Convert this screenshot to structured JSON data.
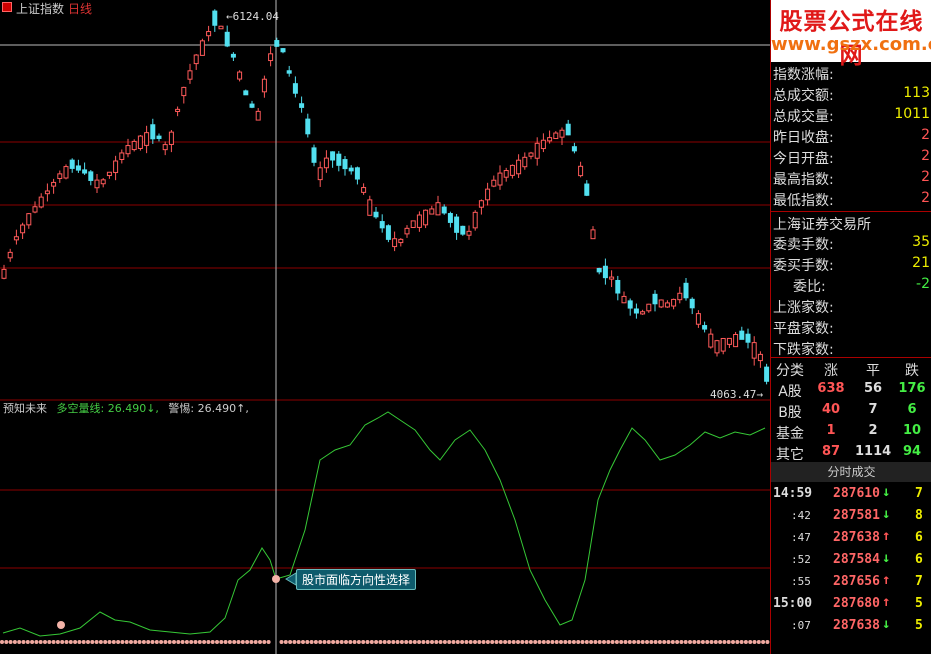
{
  "window": {
    "index_name": "上证指数",
    "period": "日线"
  },
  "chart_labels": {
    "high": "6124.04",
    "low": "4063.47"
  },
  "indicator": {
    "name": "预知未来",
    "line_name": "多空量线:",
    "line_value": "26.490↓,",
    "alert_name": "警惕:",
    "alert_value": "26.490↑,",
    "tooltip": "股市面临方向性选择"
  },
  "logo": {
    "line1": "股票公式在线网",
    "line2": "www.gszx.com.cn"
  },
  "stats": [
    {
      "label": "指数涨幅:",
      "value": ""
    },
    {
      "label": "总成交额:",
      "value": "113"
    },
    {
      "label": "总成交量:",
      "value": "1011"
    },
    {
      "label": "昨日收盘:",
      "value": "2"
    },
    {
      "label": "今日开盘:",
      "value": "2"
    },
    {
      "label": "最高指数:",
      "value": "2"
    },
    {
      "label": "最低指数:",
      "value": "2"
    }
  ],
  "exchange": {
    "title": "上海证券交易所",
    "rows": [
      {
        "label": "委卖手数:",
        "value": "35"
      },
      {
        "label": "委买手数:",
        "value": "21"
      },
      {
        "label": "委比:",
        "value": "-2"
      },
      {
        "label": "上涨家数:",
        "value": ""
      },
      {
        "label": "平盘家数:",
        "value": ""
      },
      {
        "label": "下跌家数:",
        "value": ""
      }
    ]
  },
  "categories": {
    "headers": [
      "分类",
      "涨",
      "平",
      "跌"
    ],
    "rows": [
      {
        "name": "A股",
        "up": "638",
        "flat": "56",
        "down": "176"
      },
      {
        "name": "B股",
        "up": "40",
        "flat": "7",
        "down": "6"
      },
      {
        "name": "基金",
        "up": "1",
        "flat": "2",
        "down": "10"
      },
      {
        "name": "其它",
        "up": "87",
        "flat": "1114",
        "down": "94"
      }
    ]
  },
  "trades": {
    "title": "分时成交",
    "rows": [
      {
        "time": "14:59",
        "price": "287610",
        "dir": "down",
        "vol": "7"
      },
      {
        "time": ":42",
        "price": "287581",
        "dir": "down",
        "vol": "8"
      },
      {
        "time": ":47",
        "price": "287638",
        "dir": "up",
        "vol": "6"
      },
      {
        "time": ":52",
        "price": "287584",
        "dir": "down",
        "vol": "6"
      },
      {
        "time": ":55",
        "price": "287656",
        "dir": "up",
        "vol": "7"
      },
      {
        "time": "15:00",
        "price": "287680",
        "dir": "up",
        "vol": "5"
      },
      {
        "time": ":07",
        "price": "287638",
        "dir": "down",
        "vol": "5"
      }
    ]
  },
  "colors": {
    "up_candle": "#ff5a5a",
    "down_candle": "#52e0f0",
    "indicator_line": "#36c836",
    "grid": "#8b0000",
    "crosshair": "#bbbbbb"
  }
}
